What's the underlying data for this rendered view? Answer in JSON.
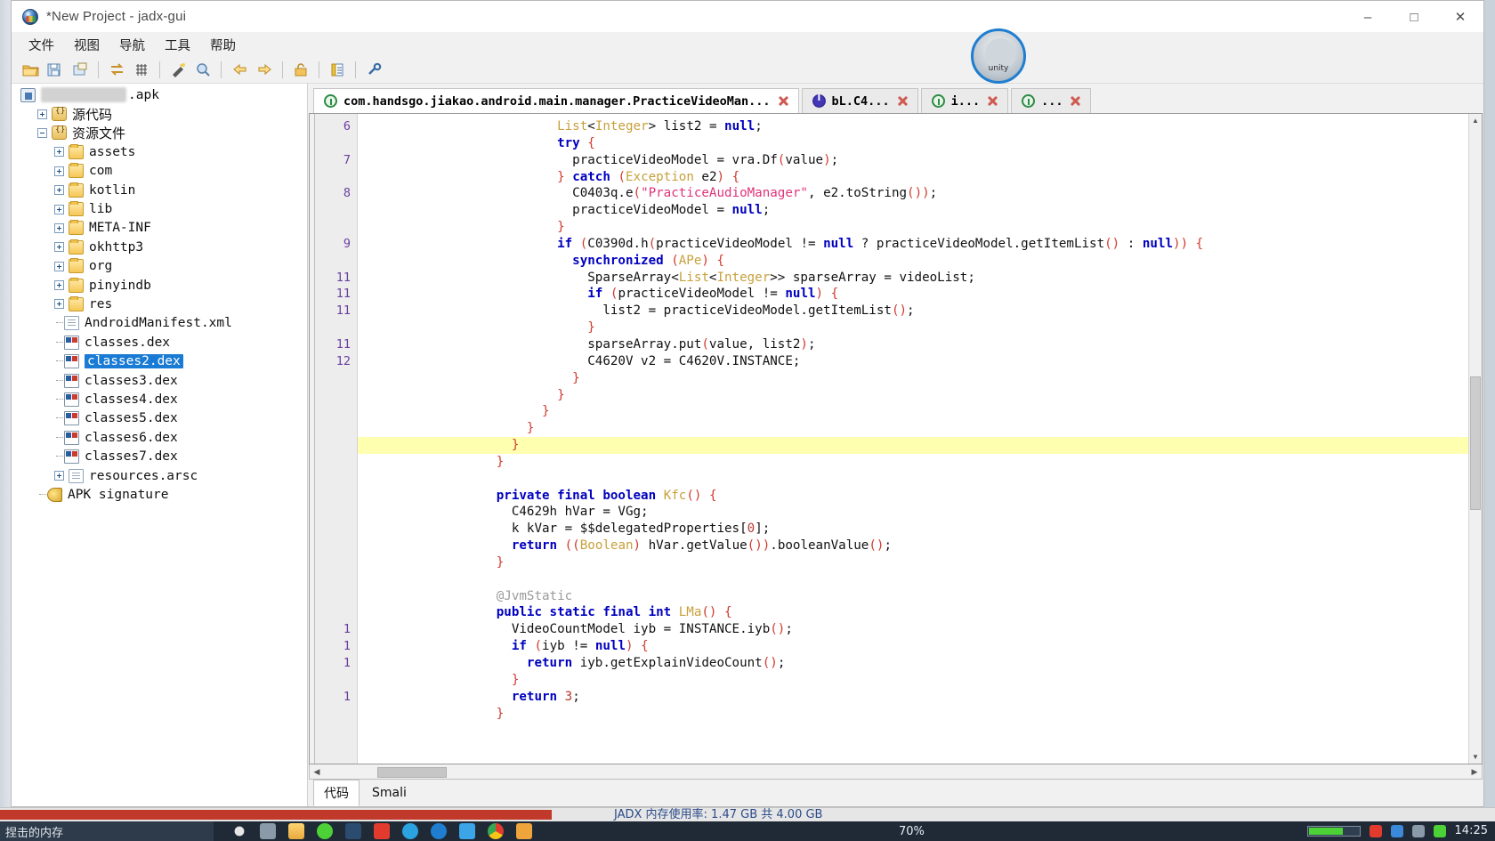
{
  "window": {
    "title": "*New Project - jadx-gui",
    "app_icon": "jadx-icon",
    "minimize": "–",
    "maximize": "□",
    "close": "✕"
  },
  "menubar": {
    "items": [
      {
        "label": "文件",
        "name": "menu-file"
      },
      {
        "label": "视图",
        "name": "menu-view"
      },
      {
        "label": "导航",
        "name": "menu-navigate"
      },
      {
        "label": "工具",
        "name": "menu-tools"
      },
      {
        "label": "帮助",
        "name": "menu-help"
      }
    ]
  },
  "toolbar": {
    "buttons": [
      {
        "icon": "open-folder-icon",
        "name": "open-file-button"
      },
      {
        "icon": "save-all-icon",
        "name": "save-all-button"
      },
      {
        "icon": "export-icon",
        "name": "export-gradle-button"
      },
      {
        "icon": "sync-icon",
        "name": "reload-button"
      },
      {
        "icon": "grid-icon",
        "name": "decompile-all-button"
      },
      {
        "icon": "wand-icon",
        "name": "deobfuscation-button"
      },
      {
        "icon": "search-icon",
        "name": "search-button"
      },
      {
        "icon": "arrow-back-icon",
        "name": "back-button"
      },
      {
        "icon": "arrow-forward-icon",
        "name": "forward-button"
      },
      {
        "icon": "lock-icon",
        "name": "open-recent-button"
      },
      {
        "icon": "log-icon",
        "name": "log-viewer-button"
      },
      {
        "icon": "wrench-icon",
        "name": "preferences-button"
      }
    ]
  },
  "tree": {
    "root": {
      "label": ".apk",
      "icon": "apk-icon",
      "blurred_prefix": true
    },
    "nodes": [
      {
        "label": "源代码",
        "icon": "package-icon",
        "indent": 1,
        "expander": "plus",
        "font": "sans"
      },
      {
        "label": "资源文件",
        "icon": "package-icon",
        "indent": 1,
        "expander": "minus",
        "font": "sans"
      },
      {
        "label": "assets",
        "icon": "folder-icon",
        "indent": 2,
        "expander": "plus",
        "font": "mono"
      },
      {
        "label": "com",
        "icon": "folder-icon",
        "indent": 2,
        "expander": "plus",
        "font": "mono"
      },
      {
        "label": "kotlin",
        "icon": "folder-icon",
        "indent": 2,
        "expander": "plus",
        "font": "mono"
      },
      {
        "label": "lib",
        "icon": "folder-icon",
        "indent": 2,
        "expander": "plus",
        "font": "mono"
      },
      {
        "label": "META-INF",
        "icon": "folder-icon",
        "indent": 2,
        "expander": "plus",
        "font": "mono"
      },
      {
        "label": "okhttp3",
        "icon": "folder-icon",
        "indent": 2,
        "expander": "plus",
        "font": "mono"
      },
      {
        "label": "org",
        "icon": "folder-icon",
        "indent": 2,
        "expander": "plus",
        "font": "mono"
      },
      {
        "label": "pinyindb",
        "icon": "folder-icon",
        "indent": 2,
        "expander": "plus",
        "font": "mono"
      },
      {
        "label": "res",
        "icon": "folder-icon",
        "indent": 2,
        "expander": "plus",
        "font": "mono"
      },
      {
        "label": "AndroidManifest.xml",
        "icon": "xml-file-icon",
        "indent": 2,
        "expander": "none",
        "font": "mono"
      },
      {
        "label": "classes.dex",
        "icon": "dex-file-icon",
        "indent": 2,
        "expander": "none",
        "font": "mono"
      },
      {
        "label": "classes2.dex",
        "icon": "dex-file-icon",
        "indent": 2,
        "expander": "none",
        "font": "mono",
        "selected": true
      },
      {
        "label": "classes3.dex",
        "icon": "dex-file-icon",
        "indent": 2,
        "expander": "none",
        "font": "mono"
      },
      {
        "label": "classes4.dex",
        "icon": "dex-file-icon",
        "indent": 2,
        "expander": "none",
        "font": "mono"
      },
      {
        "label": "classes5.dex",
        "icon": "dex-file-icon",
        "indent": 2,
        "expander": "none",
        "font": "mono"
      },
      {
        "label": "classes6.dex",
        "icon": "dex-file-icon",
        "indent": 2,
        "expander": "none",
        "font": "mono"
      },
      {
        "label": "classes7.dex",
        "icon": "dex-file-icon",
        "indent": 2,
        "expander": "none",
        "font": "mono"
      },
      {
        "label": "resources.arsc",
        "icon": "xml-file-icon",
        "indent": 2,
        "expander": "plus",
        "font": "mono"
      },
      {
        "label": "APK signature",
        "icon": "key-icon",
        "indent": 1,
        "expander": "none",
        "font": "mono"
      }
    ]
  },
  "tabs": [
    {
      "label": "com.handsgo.jiakao.android.main.manager.PracticeVideoMan...",
      "icon": "class-icon",
      "active": true,
      "close": "close-icon"
    },
    {
      "label": "bL.C4...",
      "icon": "interface-icon",
      "active": false,
      "close": "close-icon"
    },
    {
      "label": "i...",
      "icon": "class-icon",
      "active": false,
      "close": "close-icon"
    },
    {
      "label": "...",
      "icon": "class-icon",
      "active": false,
      "close": "close-icon"
    }
  ],
  "overlay": {
    "label": "unity",
    "name": "unity-logo-overlay"
  },
  "code": {
    "lines": [
      {
        "num": "6",
        "indent": 13,
        "tokens": [
          [
            "ty",
            "List"
          ],
          [
            "mt",
            "<"
          ],
          [
            "ty",
            "Integer"
          ],
          [
            "mt",
            "> list2 = "
          ],
          [
            "kw",
            "null"
          ],
          [
            "mt",
            ";"
          ]
        ]
      },
      {
        "num": "",
        "indent": 13,
        "tokens": [
          [
            "kw",
            "try"
          ],
          [
            "mt",
            " "
          ],
          [
            "pn",
            "{"
          ]
        ]
      },
      {
        "num": "7",
        "indent": 14,
        "tokens": [
          [
            "mt",
            "practiceVideoModel = vra.Df"
          ],
          [
            "pn",
            "("
          ],
          [
            "mt",
            "value"
          ],
          [
            "pn",
            ")"
          ],
          [
            "mt",
            ";"
          ]
        ]
      },
      {
        "num": "",
        "indent": 13,
        "tokens": [
          [
            "pn",
            "}"
          ],
          [
            "mt",
            " "
          ],
          [
            "kw",
            "catch"
          ],
          [
            "mt",
            " "
          ],
          [
            "pn",
            "("
          ],
          [
            "ty",
            "Exception"
          ],
          [
            "mt",
            " e2"
          ],
          [
            "pn",
            ")"
          ],
          [
            "mt",
            " "
          ],
          [
            "pn",
            "{"
          ]
        ]
      },
      {
        "num": "8",
        "indent": 14,
        "tokens": [
          [
            "mt",
            "C0403q.e"
          ],
          [
            "pn",
            "("
          ],
          [
            "str",
            "\"PracticeAudioManager\""
          ],
          [
            "mt",
            ", e2.toString"
          ],
          [
            "pn",
            "()"
          ],
          [
            "pn",
            ")"
          ],
          [
            "mt",
            ";"
          ]
        ]
      },
      {
        "num": "",
        "indent": 14,
        "tokens": [
          [
            "mt",
            "practiceVideoModel = "
          ],
          [
            "kw",
            "null"
          ],
          [
            "mt",
            ";"
          ]
        ]
      },
      {
        "num": "",
        "indent": 13,
        "tokens": [
          [
            "pn",
            "}"
          ]
        ]
      },
      {
        "num": "9",
        "indent": 13,
        "tokens": [
          [
            "kw",
            "if"
          ],
          [
            "mt",
            " "
          ],
          [
            "pn",
            "("
          ],
          [
            "mt",
            "C0390d.h"
          ],
          [
            "pn",
            "("
          ],
          [
            "mt",
            "practiceVideoModel != "
          ],
          [
            "kw",
            "null"
          ],
          [
            "mt",
            " ? practiceVideoModel.getItemList"
          ],
          [
            "pn",
            "()"
          ],
          [
            "mt",
            " : "
          ],
          [
            "kw",
            "null"
          ],
          [
            "pn",
            "))"
          ],
          [
            "mt",
            " "
          ],
          [
            "pn",
            "{"
          ]
        ]
      },
      {
        "num": "",
        "indent": 14,
        "tokens": [
          [
            "kw",
            "synchronized"
          ],
          [
            "mt",
            " "
          ],
          [
            "pn",
            "("
          ],
          [
            "ty",
            "APe"
          ],
          [
            "pn",
            ")"
          ],
          [
            "mt",
            " "
          ],
          [
            "pn",
            "{"
          ]
        ]
      },
      {
        "num": "11",
        "indent": 15,
        "tokens": [
          [
            "mt",
            "SparseArray<"
          ],
          [
            "ty",
            "List"
          ],
          [
            "mt",
            "<"
          ],
          [
            "ty",
            "Integer"
          ],
          [
            "mt",
            ">> sparseArray = videoList;"
          ]
        ]
      },
      {
        "num": "11",
        "indent": 15,
        "tokens": [
          [
            "kw",
            "if"
          ],
          [
            "mt",
            " "
          ],
          [
            "pn",
            "("
          ],
          [
            "mt",
            "practiceVideoModel != "
          ],
          [
            "kw",
            "null"
          ],
          [
            "pn",
            ")"
          ],
          [
            "mt",
            " "
          ],
          [
            "pn",
            "{"
          ]
        ]
      },
      {
        "num": "11",
        "indent": 16,
        "tokens": [
          [
            "mt",
            "list2 = practiceVideoModel.getItemList"
          ],
          [
            "pn",
            "()"
          ],
          [
            "mt",
            ";"
          ]
        ]
      },
      {
        "num": "",
        "indent": 15,
        "tokens": [
          [
            "pn",
            "}"
          ]
        ]
      },
      {
        "num": "11",
        "indent": 15,
        "tokens": [
          [
            "mt",
            "sparseArray.put"
          ],
          [
            "pn",
            "("
          ],
          [
            "mt",
            "value, list2"
          ],
          [
            "pn",
            ")"
          ],
          [
            "mt",
            ";"
          ]
        ]
      },
      {
        "num": "12",
        "indent": 15,
        "tokens": [
          [
            "mt",
            "C4620V v2 = C4620V.INSTANCE;"
          ]
        ]
      },
      {
        "num": "",
        "indent": 14,
        "tokens": [
          [
            "pn",
            "}"
          ]
        ]
      },
      {
        "num": "",
        "indent": 13,
        "tokens": [
          [
            "pn",
            "}"
          ]
        ]
      },
      {
        "num": "",
        "indent": 12,
        "tokens": [
          [
            "pn",
            "}"
          ]
        ]
      },
      {
        "num": "",
        "indent": 11,
        "tokens": [
          [
            "pn",
            "}"
          ]
        ]
      },
      {
        "num": "",
        "indent": 10,
        "tokens": [
          [
            "pn",
            "}"
          ]
        ],
        "highlight": true
      },
      {
        "num": "",
        "indent": 9,
        "tokens": [
          [
            "pn",
            "}"
          ]
        ]
      },
      {
        "num": "",
        "indent": 0,
        "tokens": [
          [
            "mt",
            ""
          ]
        ]
      },
      {
        "num": "",
        "indent": 9,
        "tokens": [
          [
            "kw",
            "private final"
          ],
          [
            "mt",
            " "
          ],
          [
            "kw",
            "boolean"
          ],
          [
            "mt",
            " "
          ],
          [
            "ty",
            "Kfc"
          ],
          [
            "pn",
            "()"
          ],
          [
            "mt",
            " "
          ],
          [
            "pn",
            "{"
          ]
        ]
      },
      {
        "num": "",
        "indent": 10,
        "tokens": [
          [
            "mt",
            "C4629h hVar = VGg;"
          ]
        ]
      },
      {
        "num": "",
        "indent": 10,
        "tokens": [
          [
            "mt",
            "k kVar = $$delegatedProperties["
          ],
          [
            "num",
            "0"
          ],
          [
            "mt",
            "];"
          ]
        ]
      },
      {
        "num": "",
        "indent": 10,
        "tokens": [
          [
            "kw",
            "return"
          ],
          [
            "mt",
            " "
          ],
          [
            "pn",
            "(("
          ],
          [
            "ty",
            "Boolean"
          ],
          [
            "pn",
            ")"
          ],
          [
            "mt",
            " hVar.getValue"
          ],
          [
            "pn",
            "())"
          ],
          [
            "mt",
            ".booleanValue"
          ],
          [
            "pn",
            "()"
          ],
          [
            "mt",
            ";"
          ]
        ]
      },
      {
        "num": "",
        "indent": 9,
        "tokens": [
          [
            "pn",
            "}"
          ]
        ]
      },
      {
        "num": "",
        "indent": 0,
        "tokens": [
          [
            "mt",
            ""
          ]
        ]
      },
      {
        "num": "",
        "indent": 9,
        "tokens": [
          [
            "an",
            "@JvmStatic"
          ]
        ]
      },
      {
        "num": "",
        "indent": 9,
        "tokens": [
          [
            "kw",
            "public static final"
          ],
          [
            "mt",
            " "
          ],
          [
            "kw",
            "int"
          ],
          [
            "mt",
            " "
          ],
          [
            "ty",
            "LMa"
          ],
          [
            "pn",
            "()"
          ],
          [
            "mt",
            " "
          ],
          [
            "pn",
            "{"
          ]
        ]
      },
      {
        "num": "1",
        "indent": 10,
        "tokens": [
          [
            "mt",
            "VideoCountModel iyb = INSTANCE.iyb"
          ],
          [
            "pn",
            "()"
          ],
          [
            "mt",
            ";"
          ]
        ]
      },
      {
        "num": "1",
        "indent": 10,
        "tokens": [
          [
            "kw",
            "if"
          ],
          [
            "mt",
            " "
          ],
          [
            "pn",
            "("
          ],
          [
            "mt",
            "iyb != "
          ],
          [
            "kw",
            "null"
          ],
          [
            "pn",
            ")"
          ],
          [
            "mt",
            " "
          ],
          [
            "pn",
            "{"
          ]
        ]
      },
      {
        "num": "1",
        "indent": 11,
        "tokens": [
          [
            "kw",
            "return"
          ],
          [
            "mt",
            " iyb.getExplainVideoCount"
          ],
          [
            "pn",
            "()"
          ],
          [
            "mt",
            ";"
          ]
        ]
      },
      {
        "num": "",
        "indent": 10,
        "tokens": [
          [
            "pn",
            "}"
          ]
        ]
      },
      {
        "num": "1",
        "indent": 10,
        "tokens": [
          [
            "kw",
            "return"
          ],
          [
            "mt",
            " "
          ],
          [
            "num",
            "3"
          ],
          [
            "mt",
            ";"
          ]
        ]
      },
      {
        "num": "",
        "indent": 9,
        "tokens": [
          [
            "pn",
            "}"
          ]
        ]
      }
    ]
  },
  "bottom_tabs": [
    {
      "label": "代码",
      "active": true,
      "name": "tab-code"
    },
    {
      "label": "Smali",
      "active": false,
      "name": "tab-smali"
    }
  ],
  "status": {
    "jady_text": "JADX  内存使用率: 1.47 GB 共 4.00 GB"
  },
  "taskbar": {
    "left_label": "捏击的内存",
    "zoom": "70%",
    "time": "14:25"
  }
}
